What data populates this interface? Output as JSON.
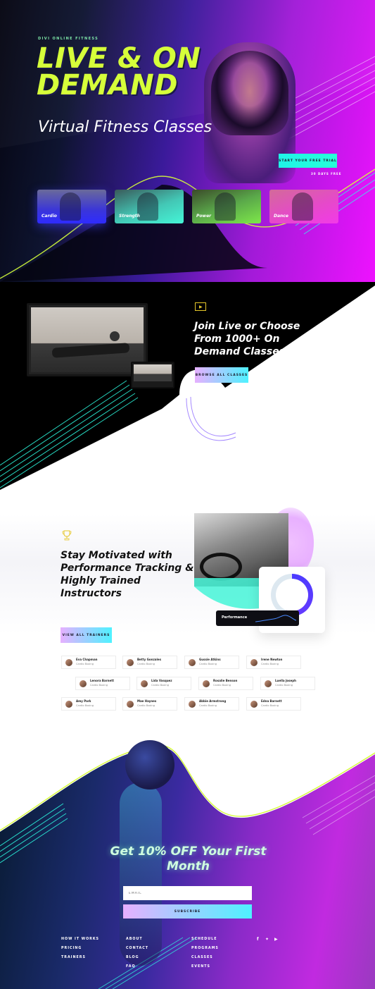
{
  "hero": {
    "eyebrow": "DIVI ONLINE FITNESS",
    "title": "LIVE & ON DEMAND",
    "subtitle": "Virtual Fitness Classes",
    "cta_label": "START YOUR FREE TRIAL",
    "cta_note": "30 DAYS FREE",
    "categories": [
      {
        "label": "Cardio",
        "color": "#2e2bff"
      },
      {
        "label": "Strength",
        "color": "#45f5d7"
      },
      {
        "label": "Power",
        "color": "#7ee84a"
      },
      {
        "label": "Dance",
        "color": "#f23ae8"
      }
    ],
    "accent_color": "#d6ff3a"
  },
  "join": {
    "heading": "Join Live or Choose From 1000+ On Demand Classes",
    "button_label": "BROWSE ALL CLASSES"
  },
  "trainers": {
    "heading": "Stay Motivated with Performance Tracking & Highly Trained Instructors",
    "performance_label": "Performance",
    "button_label": "VIEW ALL TRAINERS",
    "list": [
      {
        "name": "Eva Chapman",
        "role": "Cardio Boxing"
      },
      {
        "name": "Betty Gonzales",
        "role": "Cardio Boxing"
      },
      {
        "name": "Gussie Atkins",
        "role": "Cardio Boxing"
      },
      {
        "name": "Irene Newton",
        "role": "Cardio Boxing"
      },
      {
        "name": "Lenora Barnett",
        "role": "Cardio Boxing"
      },
      {
        "name": "Lida Vasquez",
        "role": "Cardio Boxing"
      },
      {
        "name": "Rosalie Benson",
        "role": "Cardio Boxing"
      },
      {
        "name": "Luella Joseph",
        "role": "Cardio Boxing"
      },
      {
        "name": "Amy Park",
        "role": "Cardio Boxing"
      },
      {
        "name": "Mae Haynes",
        "role": "Cardio Boxing"
      },
      {
        "name": "Abbie Armstrong",
        "role": "Cardio Boxing"
      },
      {
        "name": "Edna Barnett",
        "role": "Cardio Boxing"
      }
    ]
  },
  "promo": {
    "heading": "Get 10% OFF Your First Month",
    "email_placeholder": "EMAIL",
    "subscribe_label": "SUBSCRIBE"
  },
  "footer": {
    "col1": [
      "HOW IT WORKS",
      "PRICING",
      "TRAINERS"
    ],
    "col2": [
      "ABOUT",
      "CONTACT",
      "BLOG",
      "FAQ"
    ],
    "col3": [
      "SCHEDULE",
      "PROGRAMS",
      "CLASSES",
      "EVENTS"
    ],
    "social": [
      "facebook-icon",
      "twitter-icon",
      "youtube-icon"
    ]
  }
}
